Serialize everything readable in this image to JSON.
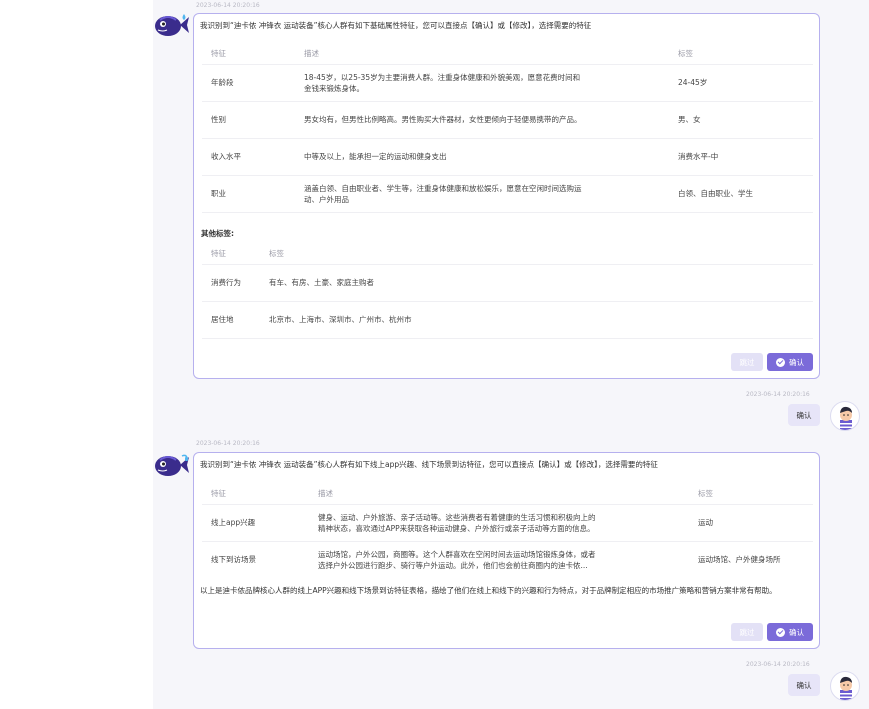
{
  "colors": {
    "accent": "#7b6bd9",
    "card_border": "#b6b0ee",
    "chat_bg": "#f6f6fa",
    "user_bubble": "#e7e5f8"
  },
  "messages": {
    "m1": {
      "timestamp": "2023-06-14 20:20:16",
      "intro": "我识别到“迪卡侬 冲锋衣 运动装备”核心人群有如下基础属性特征，您可以直接点【确认】或【修改】，选择需要的特征",
      "headers": {
        "feature": "特征",
        "desc": "描述",
        "tag": "标签"
      },
      "rows": [
        {
          "feature": "年龄段",
          "desc1": "18-45岁，以25-35岁为主要消费人群。注重身体健康和外貌美观，愿意花费时间和",
          "desc2": "金钱来锻炼身体。",
          "tag": "24-45岁"
        },
        {
          "feature": "性别",
          "desc1": "男女均有，但男性比例略高。男性购买大件器材，女性更倾向于轻便易携带的产品。",
          "desc2": "",
          "tag": "男、女"
        },
        {
          "feature": "收入水平",
          "desc1": "中等及以上，能承担一定的运动和健身支出",
          "desc2": "",
          "tag": "消费水平-中"
        },
        {
          "feature": "职业",
          "desc1": "涵盖白领、自由职业者、学生等，注重身体健康和放松娱乐，愿意在空闲时间选购运",
          "desc2": "动、户外用品",
          "tag": "白领、自由职业、学生"
        }
      ],
      "other_title": "其他标签:",
      "other_headers": {
        "feature": "特征",
        "tag": "标签"
      },
      "other_rows": [
        {
          "feature": "消费行为",
          "tag": "有车、有房、土豪、家庭主购者"
        },
        {
          "feature": "居住地",
          "tag": "北京市、上海市、深圳市、广州市、杭州市"
        }
      ],
      "skip_label": "跳过",
      "ok_label": "确认"
    },
    "u1": {
      "timestamp": "2023-06-14 20:20:16",
      "text": "确认"
    },
    "m2": {
      "timestamp": "2023-06-14 20:20:16",
      "intro": "我识别到“迪卡侬 冲锋衣 运动装备”核心人群有如下线上app兴趣、线下场景到访特征，您可以直接点【确认】或【修改】，选择需要的特征",
      "headers": {
        "feature": "特征",
        "desc": "描述",
        "tag": "标签"
      },
      "rows": [
        {
          "feature": "线上app兴趣",
          "desc1": "健身、运动、户外旅游、亲子活动等。这些消费者有着健康的生活习惯和积极向上的",
          "desc2": "精神状态，喜欢通过APP来获取各种运动健身、户外旅行或亲子活动等方面的信息。",
          "tag": "运动"
        },
        {
          "feature": "线下到访场景",
          "desc1": "运动场馆，户外公园，商圈等。这个人群喜欢在空闲时间去运动场馆锻炼身体，或者",
          "desc2": "选择户外公园进行跑步、骑行等户外运动。此外，他们也会前往商圈内的迪卡侬...",
          "tag": "运动场馆、户外健身场所"
        }
      ],
      "summary": "以上是迪卡侬品牌核心人群的线上APP兴趣和线下场景到访特征表格，描绘了他们在线上和线下的兴趣和行为特点，对于品牌制定相应的市场推广策略和营销方案非常有帮助。",
      "skip_label": "跳过",
      "ok_label": "确认"
    },
    "u2": {
      "timestamp": "2023-06-14 20:20:16",
      "text": "确认"
    }
  },
  "icons": {
    "bot": "fish-mascot-icon",
    "user": "user-avatar-icon",
    "check": "check-circle-icon"
  }
}
